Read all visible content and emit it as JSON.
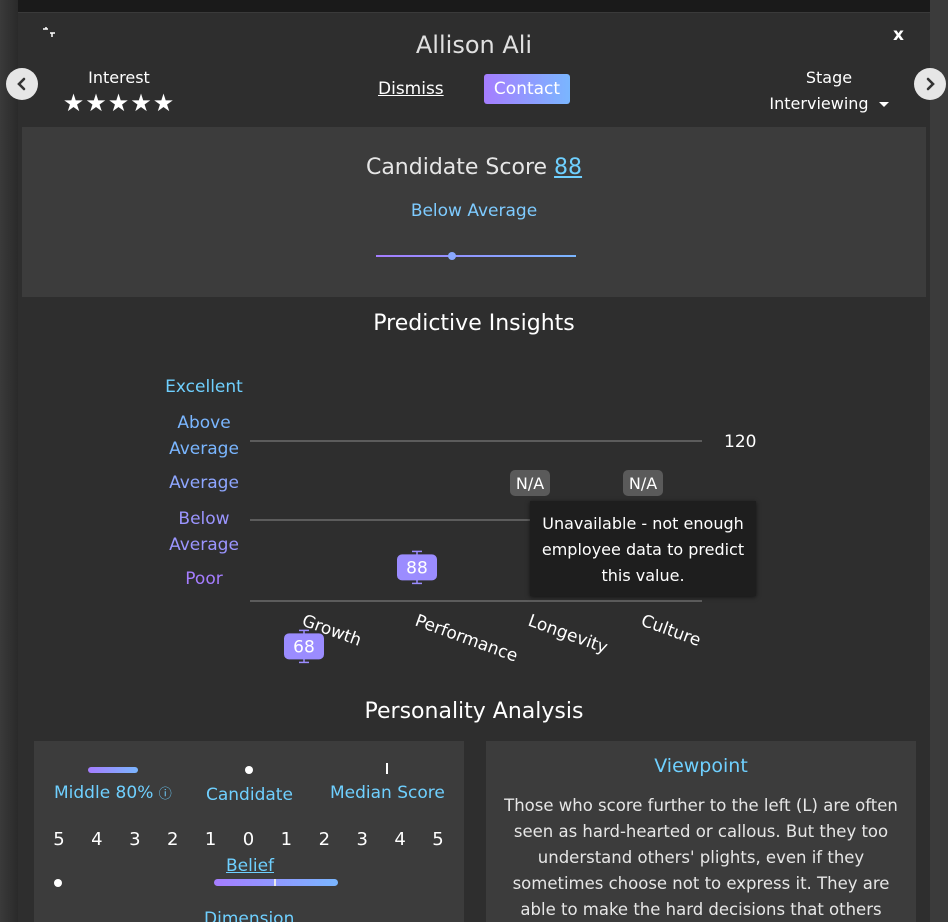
{
  "header": {
    "candidate_name": "Allison Ali",
    "close_label": "x",
    "interest_label": "Interest",
    "interest_stars": 5,
    "interest_rating": 0,
    "dismiss_label": "Dismiss",
    "contact_label": "Contact",
    "stage_label": "Stage",
    "stage_value": "Interviewing"
  },
  "score": {
    "title": "Candidate Score",
    "value": "88",
    "description": "Below Average",
    "slider_fraction": 0.38
  },
  "insights": {
    "title": "Predictive Insights",
    "tooltip": "Unavailable - not enough employee data to predict this value."
  },
  "chart_data": {
    "type": "scatter",
    "categories": [
      "Growth",
      "Performance",
      "Longevity",
      "Culture"
    ],
    "y_levels": [
      "Excellent",
      "Above Average",
      "Average",
      "Below Average",
      "Poor"
    ],
    "values": [
      68,
      88,
      null,
      null
    ],
    "value_labels": [
      "68",
      "88",
      "N/A",
      "N/A"
    ],
    "reference_lines": [
      {
        "value": 120,
        "label": "120"
      },
      {
        "value": 100,
        "label": ""
      }
    ],
    "colors": {
      "axis": "#9b7dff",
      "level_text_top": "#6fd0ff",
      "level_text_bottom": "#a57dff",
      "marker": "#9b8cff",
      "na_marker": "#5a5a5a"
    }
  },
  "personality": {
    "title": "Personality Analysis",
    "legend": {
      "middle_label": "Middle 80%",
      "candidate_label": "Candidate",
      "median_label": "Median Score"
    },
    "scale": [
      "5",
      "4",
      "3",
      "2",
      "1",
      "0",
      "1",
      "2",
      "3",
      "4",
      "5"
    ],
    "belief_label": "Belief",
    "dimension_label": "Dimension",
    "viewpoint_title": "Viewpoint",
    "viewpoint_text": "Those who score further to the left (L) are often seen as hard-hearted or callous. But they too understand others' plights, even if they sometimes choose not to express it. They are able to make the hard decisions that others"
  },
  "colors": {
    "accent_gradient_start": "#a57dff",
    "accent_gradient_end": "#7ab6ff",
    "link": "#6fd0ff"
  }
}
